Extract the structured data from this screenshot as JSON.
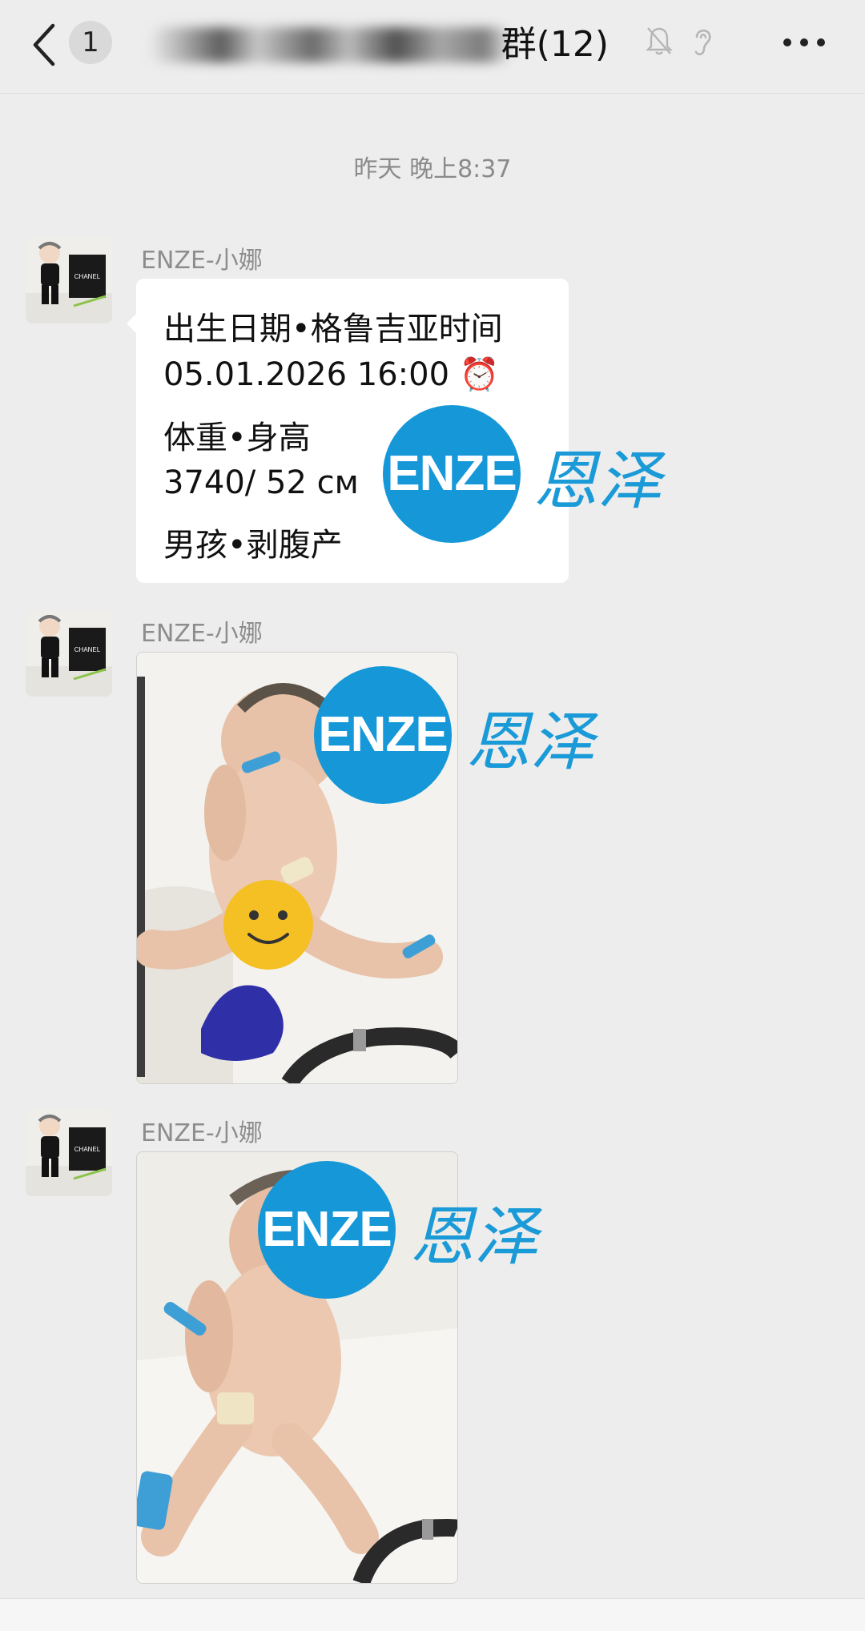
{
  "header": {
    "unread_count": "1",
    "title": "群(12)"
  },
  "timestamp": "昨天 晚上8:37",
  "messages": [
    {
      "sender": "ENZE-小娜",
      "lines": [
        "出生日期•格鲁吉亚时间",
        " 05.01.2026 16:00 ⏰",
        "体重•身高",
        " 3740/ 52 см",
        "男孩•剥腹产"
      ]
    },
    {
      "sender": "ENZE-小娜"
    },
    {
      "sender": "ENZE-小娜"
    }
  ],
  "watermark": {
    "logo_text": "ENZE",
    "brand_text": "恩泽",
    "color": "#1597d8"
  },
  "avatar_logo_text": "CHANEL"
}
